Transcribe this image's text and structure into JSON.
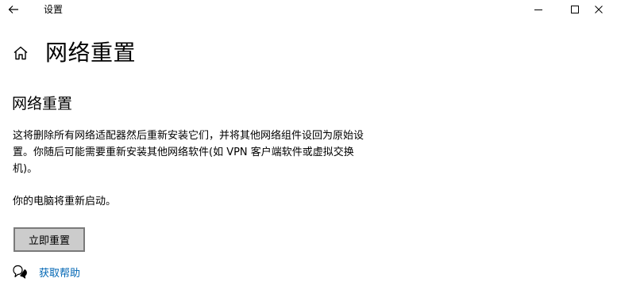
{
  "window": {
    "title": "设置"
  },
  "header": {
    "page_title": "网络重置"
  },
  "main": {
    "section_title": "网络重置",
    "description": "这将删除所有网络适配器然后重新安装它们，并将其他网络组件设回为原始设置。你随后可能需要重新安装其他网络软件(如 VPN 客户端软件或虚拟交换机)。",
    "restart_note": "你的电脑将重新启动。",
    "reset_button_label": "立即重置",
    "help_link_label": "获取帮助"
  },
  "icons": {
    "back": "back-arrow-icon",
    "home": "home-icon",
    "minimize": "minimize-icon",
    "maximize": "maximize-icon",
    "close": "close-icon",
    "help": "help-chat-icon"
  },
  "colors": {
    "link": "#0066b4",
    "button_bg": "#cccccc",
    "button_border": "#7a7a7a"
  }
}
